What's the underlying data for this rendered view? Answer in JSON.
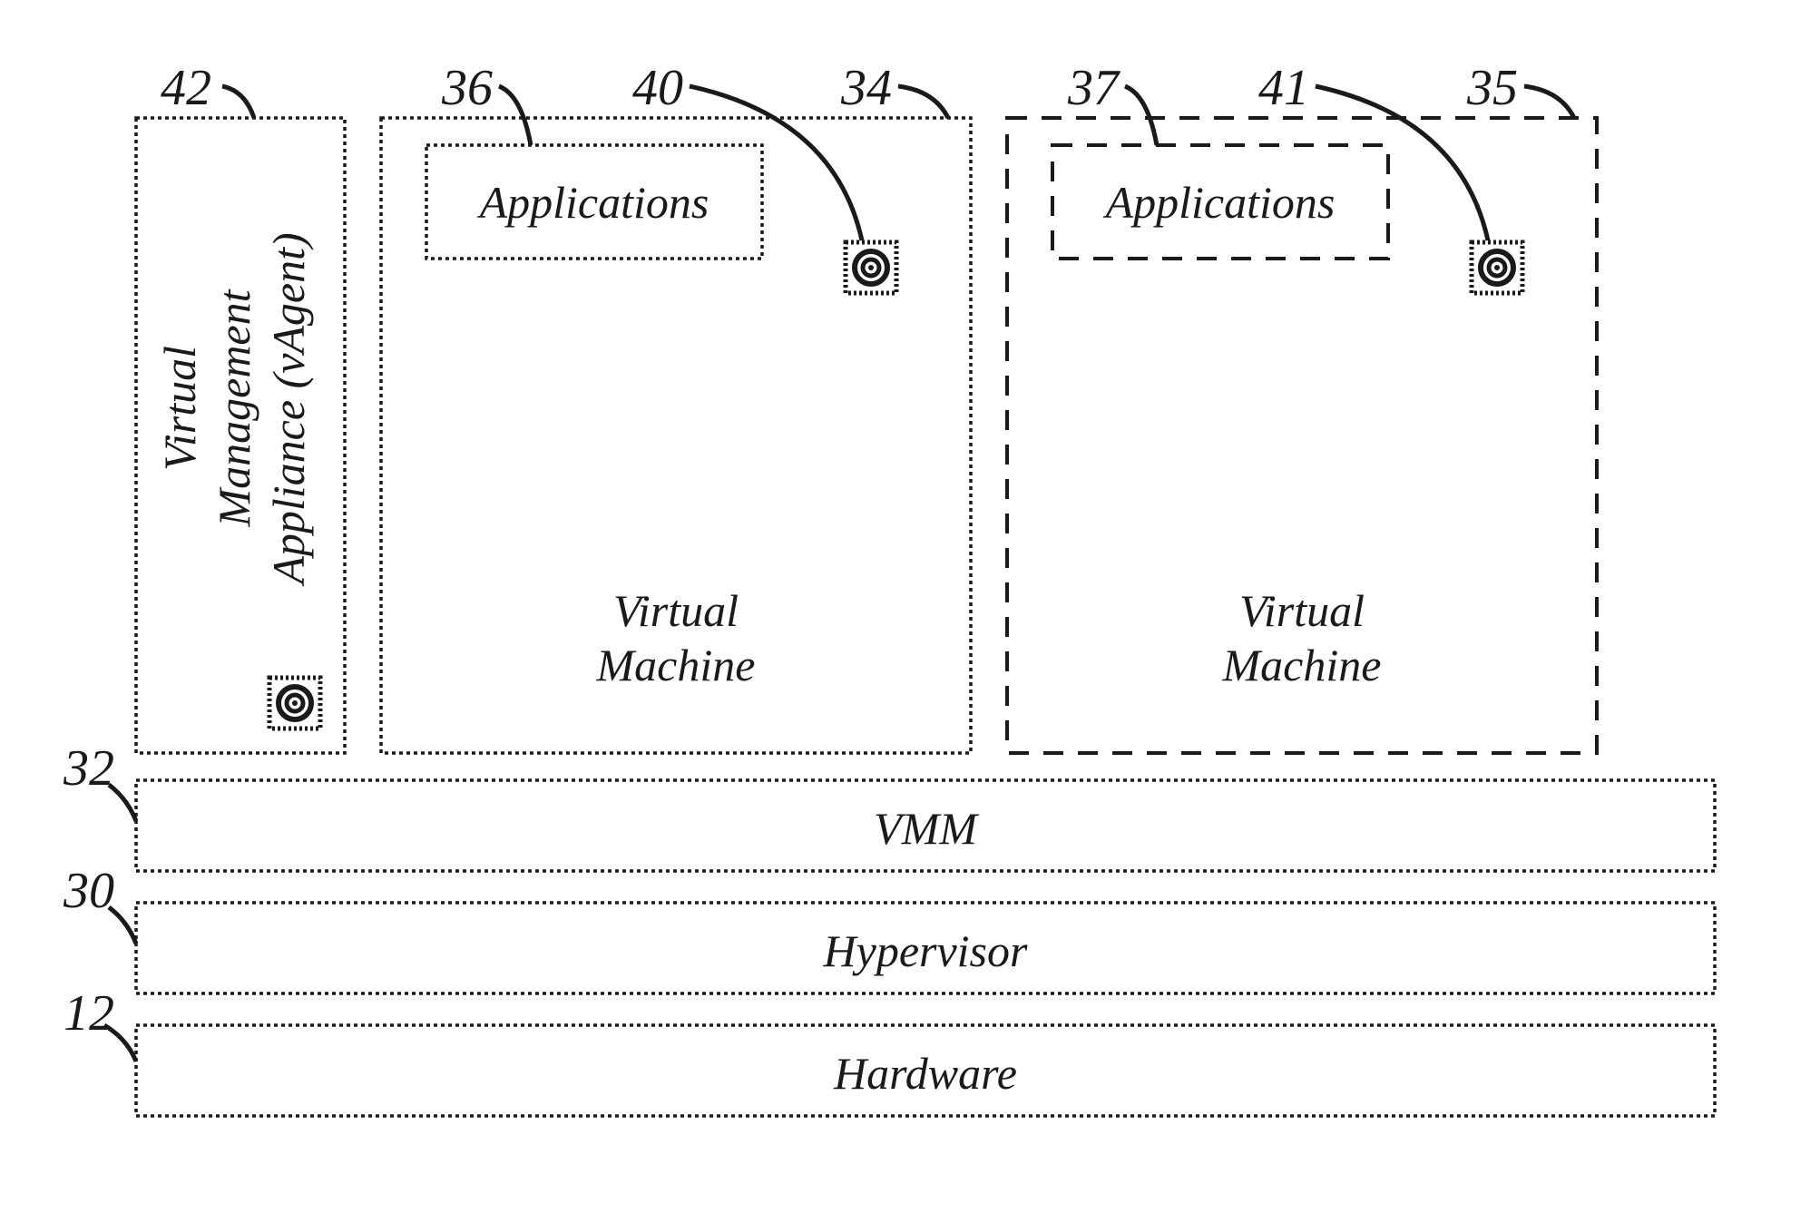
{
  "layers": {
    "hardware": {
      "label": "Hardware",
      "ref": "12"
    },
    "hypervisor": {
      "label": "Hypervisor",
      "ref": "30"
    },
    "vmm": {
      "label": "VMM",
      "ref": "32"
    }
  },
  "top_row": {
    "vagent": {
      "ref": "42",
      "line1": "Virtual",
      "line2": "Management",
      "line3": "Appliance (vAgent)"
    },
    "vm1": {
      "box_ref": "34",
      "app_ref": "36",
      "agent_ref": "40",
      "app_label": "Applications",
      "vm_line1": "Virtual",
      "vm_line2": "Machine"
    },
    "vm2": {
      "box_ref": "35",
      "app_ref": "37",
      "agent_ref": "41",
      "app_label": "Applications",
      "vm_line1": "Virtual",
      "vm_line2": "Machine"
    }
  }
}
